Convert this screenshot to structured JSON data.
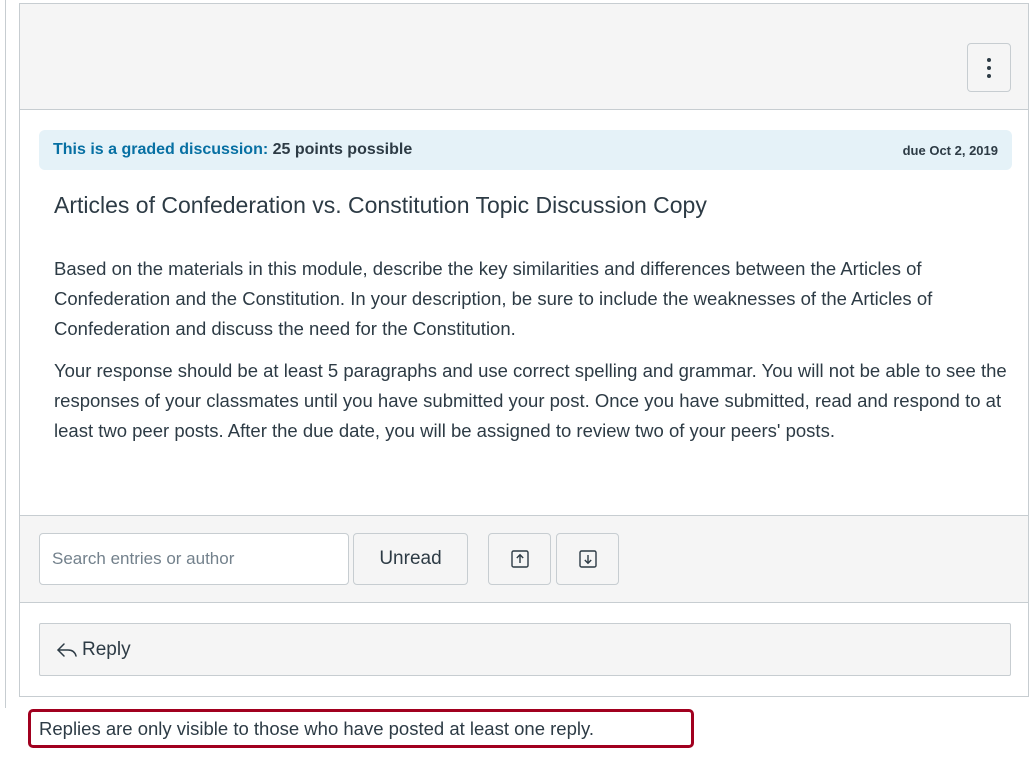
{
  "header": {
    "options_icon": "kebab-vertical-icon"
  },
  "graded_banner": {
    "label": "This is a graded discussion:",
    "points": "25 points possible",
    "due": "due Oct 2, 2019",
    "accent_color": "#0770a3",
    "background_color": "#e5f2f8"
  },
  "topic": {
    "title": "Articles of Confederation vs. Constitution Topic Discussion Copy",
    "paragraphs": [
      "Based on the materials in this module, describe the key similarities and differences between the Articles of Confederation and the Constitution. In your description, be sure to include the weaknesses of the Articles of Confederation and discuss the need for the Constitution.",
      "Your response should be at least 5 paragraphs and use correct spelling and grammar. You will not be able to see the responses of your classmates until you have submitted your post. Once you have submitted, read and respond to at least two peer posts. After the due date, you will be assigned to review two of your peers' posts."
    ]
  },
  "toolbar": {
    "search_placeholder": "Search entries or author",
    "search_value": "",
    "unread_label": "Unread",
    "collapse_icon": "arrow-up-box-icon",
    "expand_icon": "arrow-down-box-icon"
  },
  "reply": {
    "label": "Reply",
    "icon": "reply-arrow-icon"
  },
  "notice": {
    "text": "Replies are only visible to those who have posted at least one reply.",
    "highlight_color": "#a1001f"
  }
}
